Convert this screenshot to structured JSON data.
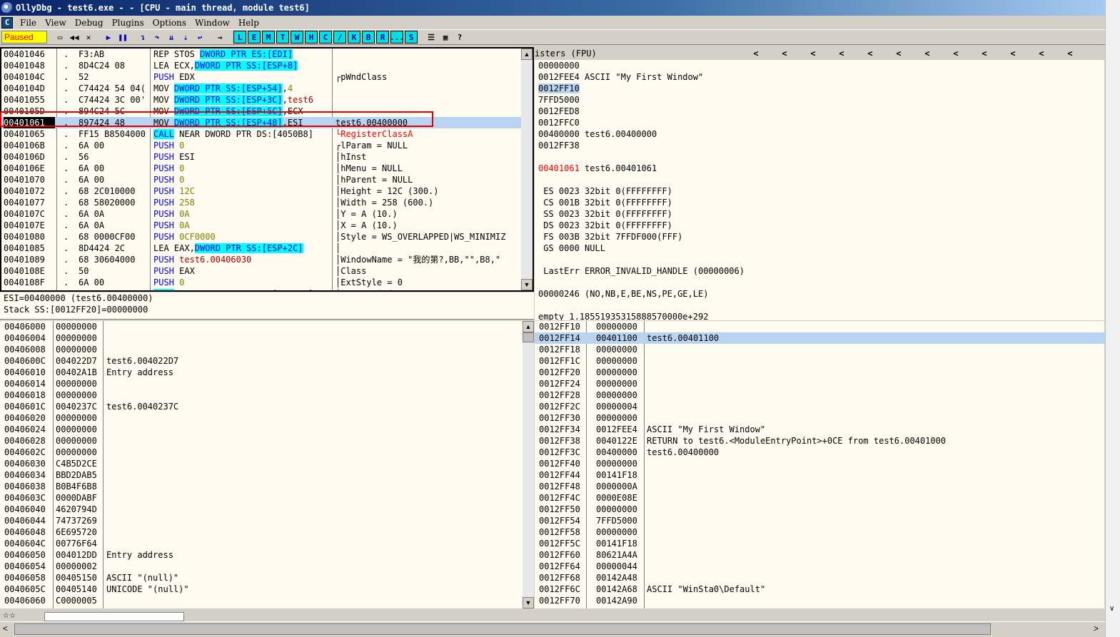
{
  "window": {
    "title": "OllyDbg - test6.exe - - [CPU - main thread, module test6]"
  },
  "menubar": {
    "c_label": "C",
    "items": [
      "File",
      "View",
      "Debug",
      "Plugins",
      "Options",
      "Window",
      "Help"
    ]
  },
  "toolbar": {
    "status": "Paused",
    "letters": [
      "L",
      "E",
      "M",
      "T",
      "W",
      "H",
      "C",
      "/",
      "K",
      "B",
      "R",
      "...",
      "S"
    ]
  },
  "cpu": {
    "rows": [
      {
        "addr": "00401046",
        "m": ".",
        "hex": "F3:AB",
        "dis": [
          {
            "t": "REP STOS "
          },
          {
            "t": "DWORD PTR ES:[EDI]",
            "c": "hl"
          }
        ],
        "cmt": ""
      },
      {
        "addr": "00401048",
        "m": ".",
        "hex": "8D4C24 08",
        "dis": [
          {
            "t": "LEA ECX,"
          },
          {
            "t": "DWORD PTR SS:[ESP+8]",
            "c": "hl"
          }
        ],
        "cmt": ""
      },
      {
        "addr": "0040104C",
        "m": ".",
        "hex": "52",
        "dis": [
          {
            "t": "PUSH",
            "c": "kw-push"
          },
          {
            "t": " EDX"
          }
        ],
        "cmt": "┌pWndClass"
      },
      {
        "addr": "0040104D",
        "m": ".",
        "hex": "C74424 54 04(",
        "dis": [
          {
            "t": "MOV "
          },
          {
            "t": "DWORD PTR SS:[ESP+54]",
            "c": "hl"
          },
          {
            "t": ","
          },
          {
            "t": "4",
            "c": "num"
          }
        ],
        "cmt": ""
      },
      {
        "addr": "00401055",
        "m": ".",
        "hex": "C74424 3C 00'",
        "dis": [
          {
            "t": "MOV "
          },
          {
            "t": "DWORD PTR SS:[ESP+3C]",
            "c": "hl"
          },
          {
            "t": ","
          },
          {
            "t": "test6",
            "c": "maroon"
          }
        ],
        "cmt": ""
      },
      {
        "addr": "0040105D",
        "m": ".",
        "hex": "894C24 5C",
        "dis": [
          {
            "t": "MOV "
          },
          {
            "t": "DWORD PTR SS:[ESP+5C]",
            "c": "hl"
          },
          {
            "t": ",ECX"
          }
        ],
        "cmt": ""
      },
      {
        "addr": "00401061",
        "m": ".",
        "hex": "897424 48",
        "dis": [
          {
            "t": "MOV "
          },
          {
            "t": "DWORD PTR SS:[ESP+48]",
            "c": "hl"
          },
          {
            "t": ",ESI"
          }
        ],
        "cmt": "test6.00400000",
        "selected": true
      },
      {
        "addr": "00401065",
        "m": ".",
        "hex": "FF15 B8504000",
        "dis": [
          {
            "t": "CALL",
            "c": "kw-call"
          },
          {
            "t": " NEAR DWORD PTR DS:[4050B8]"
          }
        ],
        "cmt": "└RegisterClassA",
        "cmtc": "red"
      },
      {
        "addr": "0040106B",
        "m": ".",
        "hex": "6A 00",
        "dis": [
          {
            "t": "PUSH",
            "c": "kw-push"
          },
          {
            "t": " "
          },
          {
            "t": "0",
            "c": "num"
          }
        ],
        "cmt": "┌lParam = NULL"
      },
      {
        "addr": "0040106D",
        "m": ".",
        "hex": "56",
        "dis": [
          {
            "t": "PUSH",
            "c": "kw-push"
          },
          {
            "t": " ESI"
          }
        ],
        "cmt": "│hInst"
      },
      {
        "addr": "0040106E",
        "m": ".",
        "hex": "6A 00",
        "dis": [
          {
            "t": "PUSH",
            "c": "kw-push"
          },
          {
            "t": " "
          },
          {
            "t": "0",
            "c": "num"
          }
        ],
        "cmt": "│hMenu = NULL"
      },
      {
        "addr": "00401070",
        "m": ".",
        "hex": "6A 00",
        "dis": [
          {
            "t": "PUSH",
            "c": "kw-push"
          },
          {
            "t": " "
          },
          {
            "t": "0",
            "c": "num"
          }
        ],
        "cmt": "│hParent = NULL"
      },
      {
        "addr": "00401072",
        "m": ".",
        "hex": "68 2C010000",
        "dis": [
          {
            "t": "PUSH",
            "c": "kw-push"
          },
          {
            "t": " "
          },
          {
            "t": "12C",
            "c": "num"
          }
        ],
        "cmt": "│Height = 12C (300.)"
      },
      {
        "addr": "00401077",
        "m": ".",
        "hex": "68 58020000",
        "dis": [
          {
            "t": "PUSH",
            "c": "kw-push"
          },
          {
            "t": " "
          },
          {
            "t": "258",
            "c": "num"
          }
        ],
        "cmt": "│Width = 258 (600.)"
      },
      {
        "addr": "0040107C",
        "m": ".",
        "hex": "6A 0A",
        "dis": [
          {
            "t": "PUSH",
            "c": "kw-push"
          },
          {
            "t": " "
          },
          {
            "t": "0A",
            "c": "num"
          }
        ],
        "cmt": "│Y = A (10.)"
      },
      {
        "addr": "0040107E",
        "m": ".",
        "hex": "6A 0A",
        "dis": [
          {
            "t": "PUSH",
            "c": "kw-push"
          },
          {
            "t": " "
          },
          {
            "t": "0A",
            "c": "num"
          }
        ],
        "cmt": "│X = A (10.)"
      },
      {
        "addr": "00401080",
        "m": ".",
        "hex": "68 0000CF00",
        "dis": [
          {
            "t": "PUSH",
            "c": "kw-push"
          },
          {
            "t": " "
          },
          {
            "t": "0CF0000",
            "c": "num"
          }
        ],
        "cmt": "│Style = WS_OVERLAPPED|WS_MINIMIZ"
      },
      {
        "addr": "00401085",
        "m": ".",
        "hex": "8D4424 2C",
        "dis": [
          {
            "t": "LEA EAX,"
          },
          {
            "t": "DWORD PTR SS:[ESP+2C]",
            "c": "hl"
          }
        ],
        "cmt": "│"
      },
      {
        "addr": "00401089",
        "m": ".",
        "hex": "68 30604000",
        "dis": [
          {
            "t": "PUSH",
            "c": "kw-push"
          },
          {
            "t": " "
          },
          {
            "t": "test6.00406030",
            "c": "maroon"
          }
        ],
        "cmt": "│WindowName = \"我的第?,BB,\"\",B8,\""
      },
      {
        "addr": "0040108E",
        "m": ".",
        "hex": "50",
        "dis": [
          {
            "t": "PUSH",
            "c": "kw-push"
          },
          {
            "t": " EAX"
          }
        ],
        "cmt": "│Class"
      },
      {
        "addr": "0040108F",
        "m": ".",
        "hex": "6A 00",
        "dis": [
          {
            "t": "PUSH",
            "c": "kw-push"
          },
          {
            "t": " "
          },
          {
            "t": "0",
            "c": "num"
          }
        ],
        "cmt": "│ExtStyle = 0"
      },
      {
        "addr": "00401091",
        "m": ".",
        "hex": "FF15 BC504000",
        "dis": [
          {
            "t": "CALL",
            "c": "kw-call"
          },
          {
            "t": " NEAR DWORD PTR DS:[4050BC]"
          }
        ],
        "cmt": "└CreateWindowExA",
        "cmtc": "red"
      }
    ]
  },
  "info": {
    "line1": "ESI=00400000 (test6.00400000)",
    "line2": "Stack SS:[0012FF20]=00000000"
  },
  "registers": {
    "header": "isters (FPU)",
    "lines": [
      {
        "t": "00000000"
      },
      {
        "t": "0012FEE4 ASCII \"My First Window\""
      },
      {
        "t": "0012FF10",
        "sel": true
      },
      {
        "t": "7FFD5000"
      },
      {
        "t": "0012FED8"
      },
      {
        "t": "0012FFC0"
      },
      {
        "t": "00400000 test6.00400000"
      },
      {
        "t": "0012FF38"
      },
      {
        "t": ""
      },
      {
        "t": "00401061 test6.00401061",
        "eip": true
      },
      {
        "t": ""
      },
      {
        "t": " ES 0023 32bit 0(FFFFFFFF)"
      },
      {
        "t": " CS 001B 32bit 0(FFFFFFFF)"
      },
      {
        "t": " SS 0023 32bit 0(FFFFFFFF)"
      },
      {
        "t": " DS 0023 32bit 0(FFFFFFFF)"
      },
      {
        "t": " FS 003B 32bit 7FFDF000(FFF)"
      },
      {
        "t": " GS 0000 NULL"
      },
      {
        "t": ""
      },
      {
        "t": " LastErr ERROR_INVALID_HANDLE (00000006)"
      },
      {
        "t": ""
      },
      {
        "t": "00000246 (NO,NB,E,BE,NS,PE,GE,LE)"
      },
      {
        "t": ""
      },
      {
        "t": "empty 1.18551935315888570000e+292"
      },
      {
        "t": "empty 2.13867123377566350000e+191"
      },
      {
        "t": "empty 2.60862194341621670000e-308"
      }
    ]
  },
  "dump": {
    "rows": [
      {
        "a": "00406000",
        "v": "00000000",
        "c": ""
      },
      {
        "a": "00406004",
        "v": "00000000",
        "c": ""
      },
      {
        "a": "00406008",
        "v": "00000000",
        "c": ""
      },
      {
        "a": "0040600C",
        "v": "004022D7",
        "c": "test6.004022D7"
      },
      {
        "a": "00406010",
        "v": "00402A1B",
        "c": "Entry address"
      },
      {
        "a": "00406014",
        "v": "00000000",
        "c": ""
      },
      {
        "a": "00406018",
        "v": "00000000",
        "c": ""
      },
      {
        "a": "0040601C",
        "v": "0040237C",
        "c": "test6.0040237C"
      },
      {
        "a": "00406020",
        "v": "00000000",
        "c": ""
      },
      {
        "a": "00406024",
        "v": "00000000",
        "c": ""
      },
      {
        "a": "00406028",
        "v": "00000000",
        "c": ""
      },
      {
        "a": "0040602C",
        "v": "00000000",
        "c": ""
      },
      {
        "a": "00406030",
        "v": "C4B5D2CE",
        "c": ""
      },
      {
        "a": "00406034",
        "v": "BBD2DAB5",
        "c": ""
      },
      {
        "a": "00406038",
        "v": "B0B4F6B8",
        "c": ""
      },
      {
        "a": "0040603C",
        "v": "0000DABF",
        "c": ""
      },
      {
        "a": "00406040",
        "v": "4620794D",
        "c": ""
      },
      {
        "a": "00406044",
        "v": "74737269",
        "c": ""
      },
      {
        "a": "00406048",
        "v": "6E695720",
        "c": ""
      },
      {
        "a": "0040604C",
        "v": "00776F64",
        "c": ""
      },
      {
        "a": "00406050",
        "v": "004012DD",
        "c": "Entry address"
      },
      {
        "a": "00406054",
        "v": "00000002",
        "c": ""
      },
      {
        "a": "00406058",
        "v": "00405150",
        "c": "ASCII \"(null)\""
      },
      {
        "a": "0040605C",
        "v": "00405140",
        "c": "UNICODE \"(null)\""
      },
      {
        "a": "00406060",
        "v": "C0000005",
        "c": ""
      }
    ]
  },
  "stack": {
    "rows": [
      {
        "a": "0012FF10",
        "v": "00000000",
        "c": ""
      },
      {
        "a": "0012FF14",
        "v": "00401100",
        "c": "test6.00401100",
        "sel": true
      },
      {
        "a": "0012FF18",
        "v": "00000000",
        "c": ""
      },
      {
        "a": "0012FF1C",
        "v": "00000000",
        "c": ""
      },
      {
        "a": "0012FF20",
        "v": "00000000",
        "c": ""
      },
      {
        "a": "0012FF24",
        "v": "00000000",
        "c": ""
      },
      {
        "a": "0012FF28",
        "v": "00000000",
        "c": ""
      },
      {
        "a": "0012FF2C",
        "v": "00000004",
        "c": ""
      },
      {
        "a": "0012FF30",
        "v": "00000000",
        "c": ""
      },
      {
        "a": "0012FF34",
        "v": "0012FEE4",
        "c": "ASCII \"My First Window\""
      },
      {
        "a": "0012FF38",
        "v": "0040122E",
        "c": "RETURN to test6.<ModuleEntryPoint>+0CE from test6.00401000"
      },
      {
        "a": "0012FF3C",
        "v": "00400000",
        "c": "test6.00400000"
      },
      {
        "a": "0012FF40",
        "v": "00000000",
        "c": ""
      },
      {
        "a": "0012FF44",
        "v": "00141F18",
        "c": ""
      },
      {
        "a": "0012FF48",
        "v": "0000000A",
        "c": ""
      },
      {
        "a": "0012FF4C",
        "v": "0000E08E",
        "c": ""
      },
      {
        "a": "0012FF50",
        "v": "00000000",
        "c": ""
      },
      {
        "a": "0012FF54",
        "v": "7FFD5000",
        "c": ""
      },
      {
        "a": "0012FF58",
        "v": "00000000",
        "c": ""
      },
      {
        "a": "0012FF5C",
        "v": "00141F18",
        "c": ""
      },
      {
        "a": "0012FF60",
        "v": "80621A4A",
        "c": ""
      },
      {
        "a": "0012FF64",
        "v": "00000044",
        "c": ""
      },
      {
        "a": "0012FF68",
        "v": "00142A48",
        "c": ""
      },
      {
        "a": "0012FF6C",
        "v": "00142A68",
        "c": "ASCII \"WinSta0\\Default\""
      },
      {
        "a": "0012FF70",
        "v": "00142A90",
        "c": ""
      }
    ]
  },
  "colors": {
    "selection": "#b8d4f0",
    "highlight": "#00ffff",
    "paused_bg": "#ffff00",
    "paused_fg": "#ff0000",
    "eip": "#ff0000"
  }
}
